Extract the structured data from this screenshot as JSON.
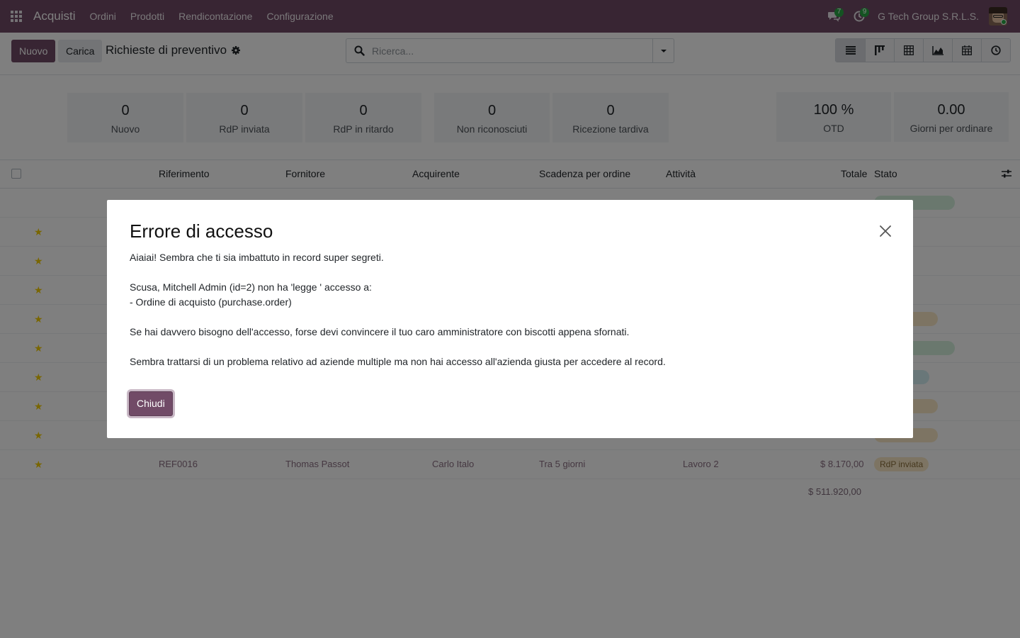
{
  "navbar": {
    "app_name": "Acquisti",
    "menu": [
      "Ordini",
      "Prodotti",
      "Rendicontazione",
      "Configurazione"
    ],
    "messages_count": "7",
    "activities_count": "9",
    "company": "G Tech Group S.R.L.S."
  },
  "control": {
    "new_label": "Nuovo",
    "upload_label": "Carica",
    "breadcrumb": "Richieste di preventivo",
    "search_placeholder": "Ricerca...",
    "views": [
      "list-view-icon",
      "kanban-view-icon",
      "pivot-view-icon",
      "graph-view-icon",
      "calendar-view-icon",
      "activity-view-icon"
    ]
  },
  "dashboard": {
    "tiles": [
      {
        "value": "0",
        "label": "Nuovo"
      },
      {
        "value": "0",
        "label": "RdP inviata"
      },
      {
        "value": "0",
        "label": "RdP in ritardo"
      },
      {
        "value": "0",
        "label": "Non riconosciuti"
      },
      {
        "value": "0",
        "label": "Ricezione tardiva"
      },
      {
        "value": "100 %",
        "label": "OTD"
      },
      {
        "value": "0.00",
        "label": "Giorni per ordinare"
      }
    ]
  },
  "list": {
    "columns": [
      "Riferimento",
      "Fornitore",
      "Acquirente",
      "Scadenza per ordine",
      "Attività",
      "Totale",
      "Stato"
    ],
    "visible_row": {
      "reference": "REF0016",
      "vendor": "Thomas Passot",
      "buyer": "Carlo Italo",
      "deadline": "Tra 5 giorni",
      "activity": "Lavoro 2",
      "total": "$ 8.170,00",
      "status": "RdP inviata"
    },
    "grand_total": "$ 511.920,00"
  },
  "modal": {
    "title": "Errore di accesso",
    "body": "Aiaiai! Sembra che ti sia imbattuto in record super segreti.\n\nScusa, Mitchell Admin (id=2) non ha  'legge ' accesso a:\n- Ordine di acquisto (purchase.order)\n\nSe hai davvero bisogno dell'accesso, forse devi convincere il tuo caro amministratore con biscotti appena sfornati.\n\nSembra trattarsi di un problema relativo ad aziende multiple ma non hai accesso all'azienda giusta per accedere al record.",
    "close_label": "Chiudi"
  },
  "colors": {
    "brand": "#714b67",
    "badge": "#28a745",
    "overlay": "rgba(0,0,0,0.5)"
  }
}
